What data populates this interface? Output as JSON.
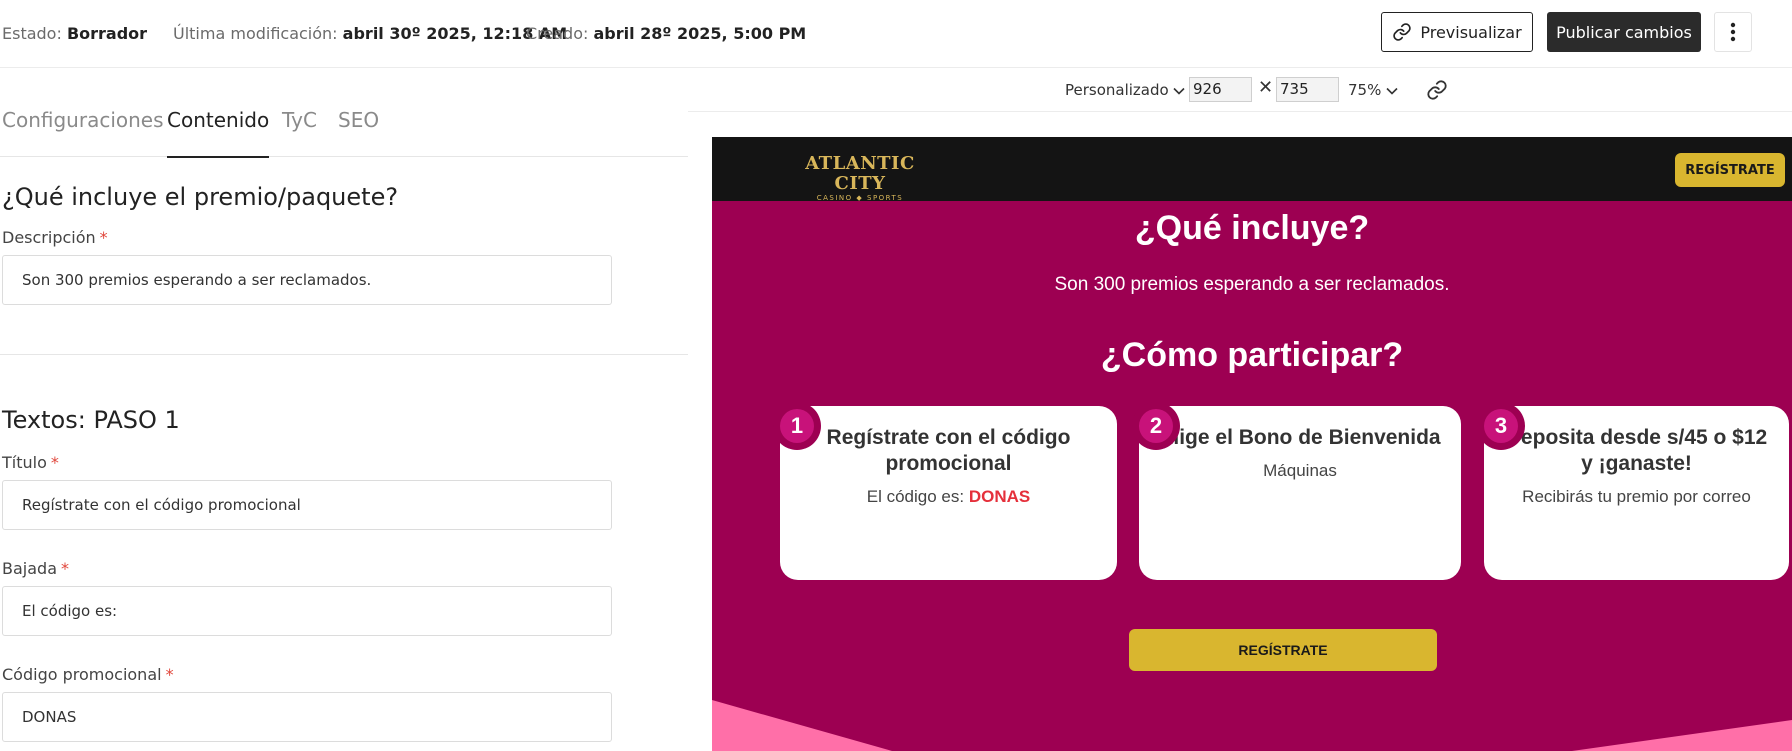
{
  "status_bar": {
    "estado_label": "Estado:",
    "estado_value": "Borrador",
    "modificacion_label": "Última modificación:",
    "modificacion_value": "abril 30º 2025, 12:18 AM",
    "creado_label": "Creado:",
    "creado_value": "abril 28º 2025, 5:00 PM"
  },
  "actions": {
    "preview_label": "Previsualizar",
    "publish_label": "Publicar cambios",
    "more_icon": "more-vertical-icon"
  },
  "tabs": [
    {
      "label": "Configuraciones",
      "active": false
    },
    {
      "label": "Contenido",
      "active": true
    },
    {
      "label": "TyC",
      "active": false
    },
    {
      "label": "SEO",
      "active": false
    }
  ],
  "section_premio": {
    "title": "¿Qué incluye el premio/paquete?",
    "descripcion_label": "Descripción",
    "descripcion_value": "Son 300 premios esperando a ser reclamados."
  },
  "section_paso1": {
    "title": "Textos: PASO 1",
    "titulo_label": "Título",
    "titulo_value": "Regístrate con el código promocional",
    "bajada_label": "Bajada",
    "bajada_value": "El código es:",
    "codigo_label": "Código promocional",
    "codigo_value": "DONAS"
  },
  "required_mark": "*",
  "preview_toolbar": {
    "preset": "Personalizado",
    "width": "926",
    "height": "735",
    "separator": "✕",
    "zoom": "75%"
  },
  "preview": {
    "logo_main": "ATLANTIC CITY",
    "logo_sub": "CASINO ◆ SPORTS",
    "header_register": "REGÍSTRATE",
    "que_incluye_title": "¿Qué incluye?",
    "que_incluye_text": "Son 300 premios esperando a ser reclamados.",
    "como_participar_title": "¿Cómo participar?",
    "steps": [
      {
        "number": "1",
        "title": "Regístrate con el código promocional",
        "subtitle": "El código es:",
        "promo": "DONAS"
      },
      {
        "number": "2",
        "title": "Elige el Bono de Bienvenida",
        "subtitle": "Máquinas"
      },
      {
        "number": "3",
        "title": "Deposita desde s/45 o $12 y ¡ganaste!",
        "subtitle": "Recibirás tu premio por correo"
      }
    ],
    "main_register": "REGÍSTRATE",
    "colors": {
      "background": "#9d0052",
      "header": "#141414",
      "gold": "#d9b62f",
      "badge": "#c8127a",
      "promo": "#e5303b",
      "wave": "#ff6fa8"
    }
  }
}
